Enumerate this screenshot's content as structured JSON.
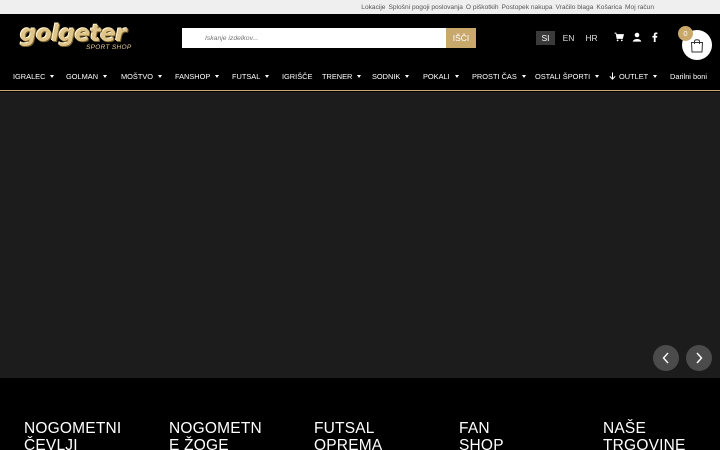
{
  "topbar": {
    "links": [
      "Lokacije",
      "Splošni pogoji poslovanja",
      "O piškotkih",
      "Postopek nakupa",
      "Vračilo blaga",
      "Košarica",
      "Moj račun"
    ]
  },
  "header": {
    "logo_text": "golgeter",
    "logo_sub": "SPORT SHOP",
    "search_placeholder": "Iskanje izdelkov...",
    "search_button": "IŠČI",
    "languages": [
      "SI",
      "EN",
      "HR"
    ],
    "active_language": "SI",
    "cart_count": "0",
    "icons": [
      "cart-icon",
      "user-icon",
      "facebook-icon",
      "shopping-bag-icon",
      "search-icon"
    ]
  },
  "nav": {
    "items": [
      {
        "label": "IGRALEC",
        "dropdown": true
      },
      {
        "label": "GOLMAN",
        "dropdown": true
      },
      {
        "label": "MOŠTVO",
        "dropdown": true
      },
      {
        "label": "FANSHOP",
        "dropdown": true
      },
      {
        "label": "FUTSAL",
        "dropdown": true
      },
      {
        "label": "IGRIŠČE",
        "dropdown": false
      },
      {
        "label": "TRENER",
        "dropdown": true
      },
      {
        "label": "SODNIK",
        "dropdown": true
      },
      {
        "label": "POKALI",
        "dropdown": true
      },
      {
        "label": "PROSTI ČAS",
        "dropdown": true
      },
      {
        "label": "OSTALI ŠPORTI",
        "dropdown": true
      },
      {
        "label": "OUTLET",
        "dropdown": true
      },
      {
        "label": "Darilni boni",
        "dropdown": false
      }
    ]
  },
  "categories": [
    {
      "line1": "NOGOMETNI",
      "line2": "ČEVLJI"
    },
    {
      "line1": "NOGOMETN",
      "line2": "E ŽOGE"
    },
    {
      "line1": "FUTSAL",
      "line2": "OPREMA"
    },
    {
      "line1": "FAN",
      "line2": "SHOP"
    },
    {
      "line1": "NAŠE",
      "line2": "TRGOVINE"
    }
  ],
  "colors": {
    "accent": "#c9a86b",
    "topbar_bg": "#efefef",
    "header_bg": "#000000",
    "slider_bg": "#1c1c1c",
    "arrow_bg": "#4b4b4b"
  }
}
